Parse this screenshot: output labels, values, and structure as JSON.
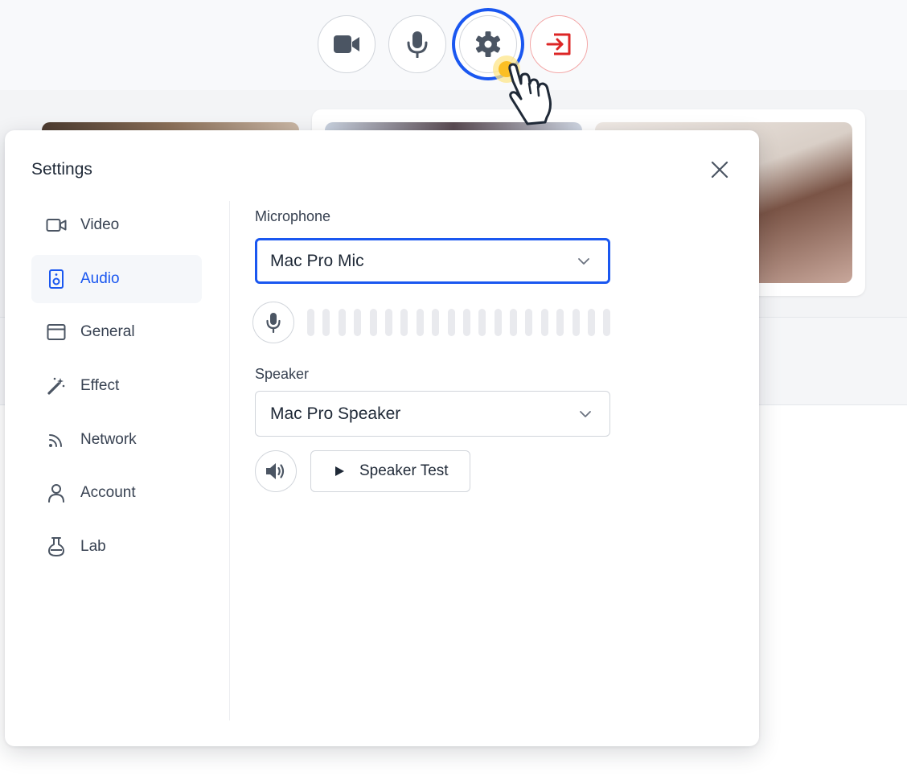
{
  "toolbar": {
    "buttons": [
      {
        "name": "camera",
        "icon": "video-camera-icon"
      },
      {
        "name": "microphone",
        "icon": "microphone-icon"
      },
      {
        "name": "settings",
        "icon": "gear-icon",
        "active": true
      },
      {
        "name": "leave",
        "icon": "exit-icon"
      }
    ]
  },
  "settings": {
    "title": "Settings",
    "nav": [
      {
        "label": "Video",
        "icon": "video-camera-icon",
        "selected": false
      },
      {
        "label": "Audio",
        "icon": "speaker-box-icon",
        "selected": true
      },
      {
        "label": "General",
        "icon": "window-icon",
        "selected": false
      },
      {
        "label": "Effect",
        "icon": "magic-wand-icon",
        "selected": false
      },
      {
        "label": "Network",
        "icon": "wifi-signal-icon",
        "selected": false
      },
      {
        "label": "Account",
        "icon": "user-icon",
        "selected": false
      },
      {
        "label": "Lab",
        "icon": "flask-icon",
        "selected": false
      }
    ],
    "microphone": {
      "label": "Microphone",
      "selected": "Mac Pro Mic",
      "level": 0
    },
    "speaker": {
      "label": "Speaker",
      "selected": "Mac Pro Speaker",
      "test_label": "Speaker Test"
    }
  },
  "colors": {
    "accent": "#1a57f0",
    "danger": "#dc2626",
    "icon": "#4b5563",
    "meter_bar": "#e9eaee"
  }
}
